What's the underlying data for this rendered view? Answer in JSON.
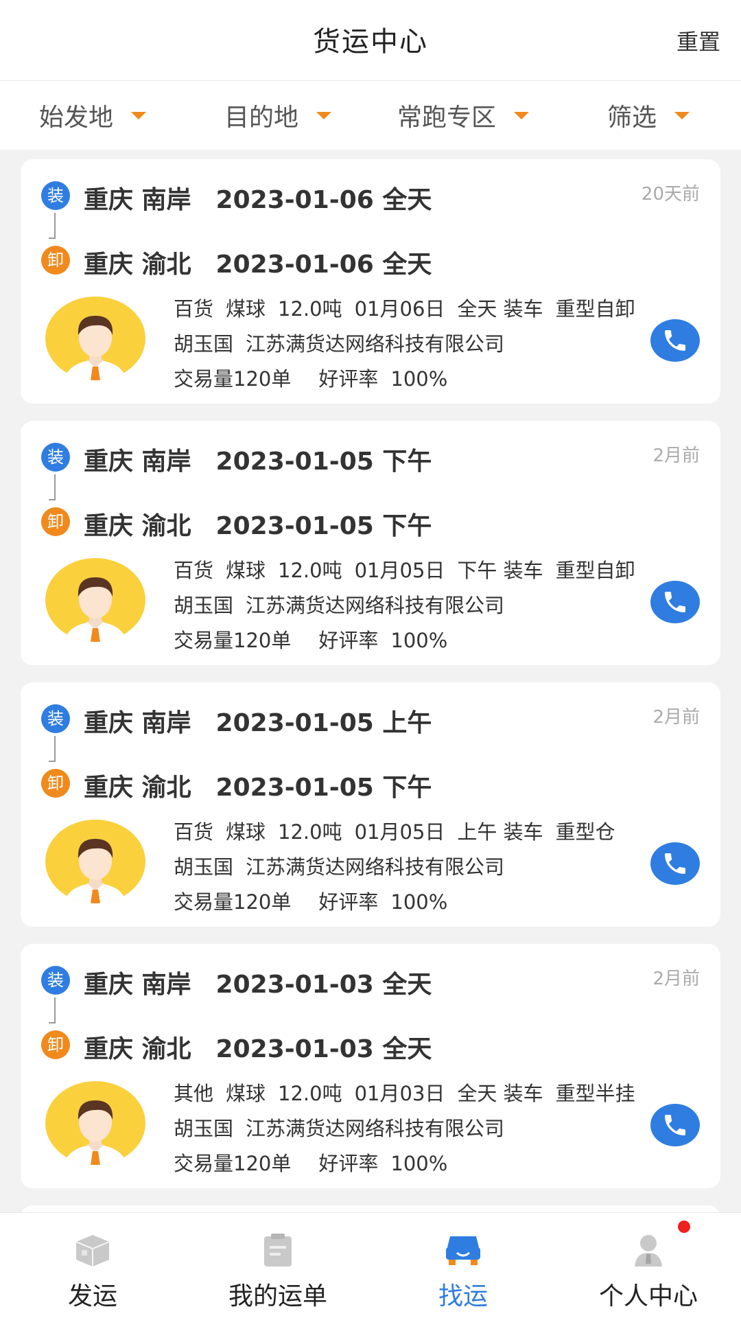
{
  "header": {
    "title": "货运中心",
    "reset": "重置"
  },
  "filters": [
    {
      "label": "始发地"
    },
    {
      "label": "目的地"
    },
    {
      "label": "常跑专区"
    },
    {
      "label": "筛选"
    }
  ],
  "accent_colors": {
    "blue": "#2f7de1",
    "orange": "#f08a1c",
    "avatar": "#fbd03d",
    "notify": "#f02020"
  },
  "badges": {
    "load": "装",
    "unload": "卸"
  },
  "cards": [
    {
      "load": {
        "place": "重庆 南岸",
        "date": "2023-01-06 全天"
      },
      "unload": {
        "place": "重庆 渝北",
        "date": "2023-01-06 全天"
      },
      "ago": "20天前",
      "cargo": {
        "type": "百货",
        "name": "煤球",
        "weight": "12.0吨",
        "date": "01月06日",
        "slot": "全天 装车",
        "truck": "重型自卸"
      },
      "contact": {
        "name": "胡玉国",
        "company": "江苏满货达网络科技有限公司"
      },
      "stats": {
        "volume": "交易量120单",
        "rating_label": "好评率",
        "rating": "100%"
      }
    },
    {
      "load": {
        "place": "重庆 南岸",
        "date": "2023-01-05 下午"
      },
      "unload": {
        "place": "重庆 渝北",
        "date": "2023-01-05 下午"
      },
      "ago": "2月前",
      "cargo": {
        "type": "百货",
        "name": "煤球",
        "weight": "12.0吨",
        "date": "01月05日",
        "slot": "下午 装车",
        "truck": "重型自卸"
      },
      "contact": {
        "name": "胡玉国",
        "company": "江苏满货达网络科技有限公司"
      },
      "stats": {
        "volume": "交易量120单",
        "rating_label": "好评率",
        "rating": "100%"
      }
    },
    {
      "load": {
        "place": "重庆 南岸",
        "date": "2023-01-05 上午"
      },
      "unload": {
        "place": "重庆 渝北",
        "date": "2023-01-05 下午"
      },
      "ago": "2月前",
      "cargo": {
        "type": "百货",
        "name": "煤球",
        "weight": "12.0吨",
        "date": "01月05日",
        "slot": "上午 装车",
        "truck": "重型仓"
      },
      "contact": {
        "name": "胡玉国",
        "company": "江苏满货达网络科技有限公司"
      },
      "stats": {
        "volume": "交易量120单",
        "rating_label": "好评率",
        "rating": "100%"
      }
    },
    {
      "load": {
        "place": "重庆 南岸",
        "date": "2023-01-03 全天"
      },
      "unload": {
        "place": "重庆 渝北",
        "date": "2023-01-03 全天"
      },
      "ago": "2月前",
      "cargo": {
        "type": "其他",
        "name": "煤球",
        "weight": "12.0吨",
        "date": "01月03日",
        "slot": "全天 装车",
        "truck": "重型半挂"
      },
      "contact": {
        "name": "胡玉国",
        "company": "江苏满货达网络科技有限公司"
      },
      "stats": {
        "volume": "交易量120单",
        "rating_label": "好评率",
        "rating": "100%"
      }
    }
  ],
  "tabs": [
    {
      "label": "发运",
      "icon": "box-icon",
      "active": false
    },
    {
      "label": "我的运单",
      "icon": "clipboard-icon",
      "active": false
    },
    {
      "label": "找运",
      "icon": "truck-icon",
      "active": true
    },
    {
      "label": "个人中心",
      "icon": "person-icon",
      "active": false
    }
  ]
}
